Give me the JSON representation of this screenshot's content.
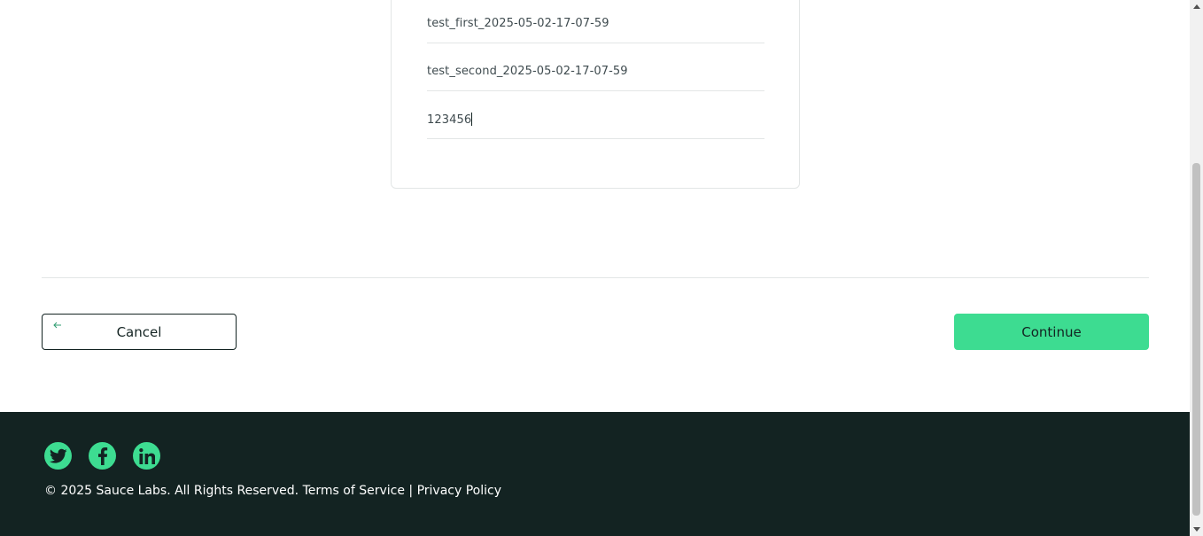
{
  "form": {
    "first_name": "test_first_2025-05-02-17-07-59",
    "last_name": "test_second_2025-05-02-17-07-59",
    "zip_code": "123456"
  },
  "actions": {
    "cancel_label": "Cancel",
    "cancel_icon": "arrow-left-icon",
    "continue_label": "Continue"
  },
  "footer": {
    "social": [
      "twitter-icon",
      "facebook-icon",
      "linkedin-icon"
    ],
    "copyright": "© 2025 Sauce Labs. All Rights Reserved.",
    "terms": "Terms of Service",
    "separator": "|",
    "privacy": "Privacy Policy"
  },
  "colors": {
    "accent": "#3ddc91",
    "footer_bg": "#132322",
    "text": "#132322"
  }
}
